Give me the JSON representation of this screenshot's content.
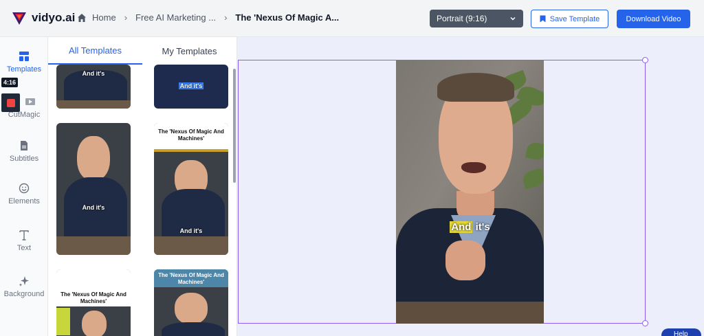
{
  "app": {
    "name": "vidyo.ai"
  },
  "breadcrumb": {
    "home": "Home",
    "section": "Free AI Marketing ...",
    "current": "The 'Nexus Of Magic A..."
  },
  "toolbar": {
    "aspect_value": "Portrait (9:16)",
    "save_label": "Save Template",
    "download_label": "Download Video"
  },
  "rail": {
    "items": [
      {
        "label": "Templates",
        "icon": "templates-icon"
      },
      {
        "label": "CutMagic",
        "icon": "cutmagic-icon"
      },
      {
        "label": "Subtitles",
        "icon": "subtitles-icon"
      },
      {
        "label": "Elements",
        "icon": "smiley-icon"
      },
      {
        "label": "Text",
        "icon": "text-icon"
      },
      {
        "label": "Background",
        "icon": "sparkle-icon"
      }
    ],
    "recording_time": "4:16"
  },
  "panel": {
    "tabs": [
      "All Templates",
      "My Templates"
    ],
    "thumbs": [
      {
        "caption": "And it's"
      },
      {
        "caption": "And it's"
      },
      {
        "caption": "And it's"
      },
      {
        "title": "The 'Nexus Of Magic And Machines'",
        "caption": "And it's"
      },
      {
        "title": "The 'Nexus Of Magic And Machines'"
      },
      {
        "title": "The 'Nexus Of Magic And Machines'"
      }
    ]
  },
  "video": {
    "caption_highlight": "And",
    "caption_rest": " it's"
  },
  "help": {
    "label": "Help"
  },
  "colors": {
    "accent": "#2563eb",
    "selection": "#8b5cf6"
  }
}
